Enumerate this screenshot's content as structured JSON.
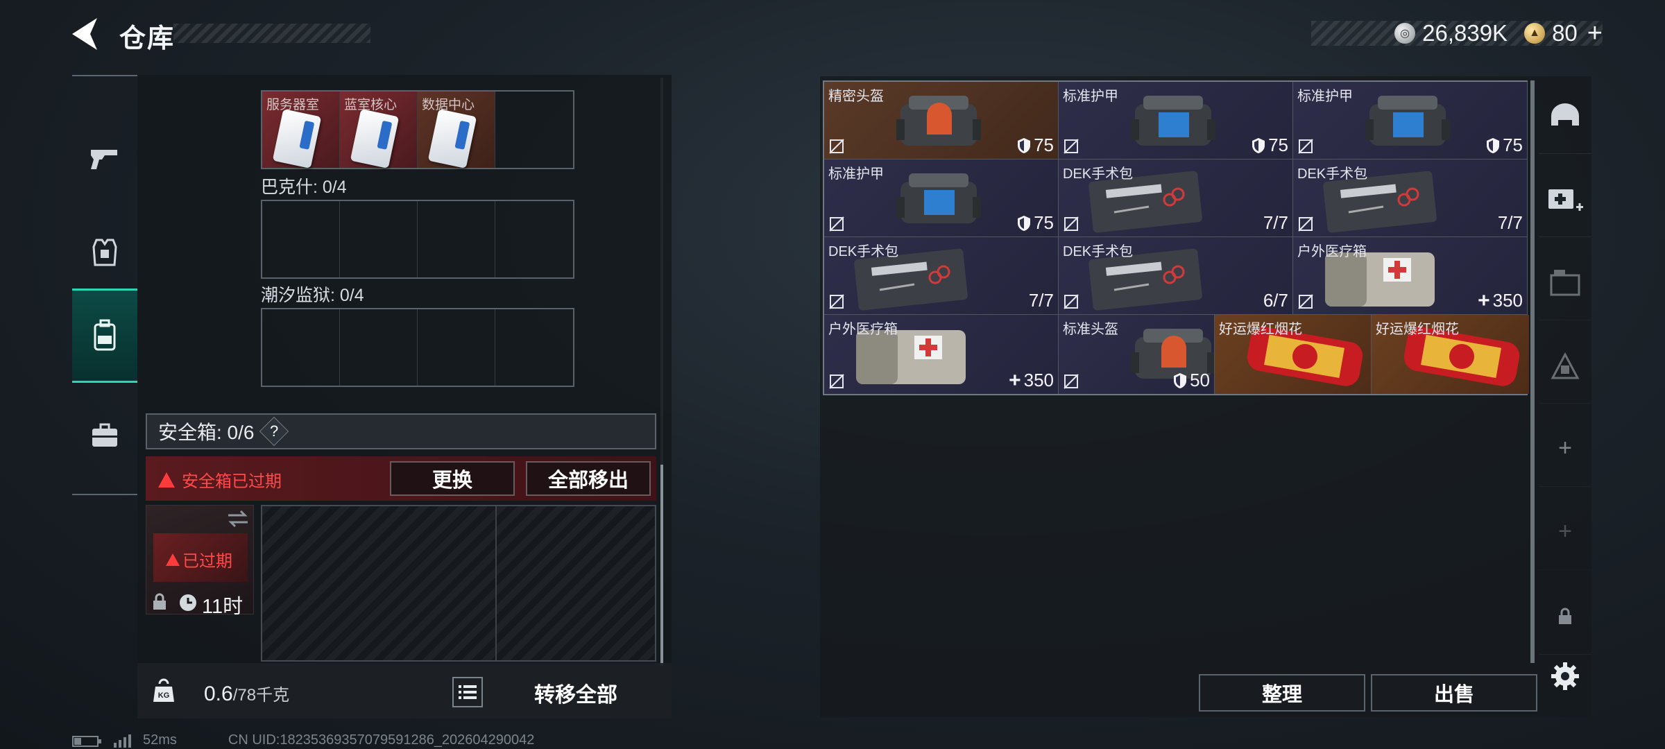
{
  "header": {
    "title": "仓库",
    "currency_silver": "26,839K",
    "currency_gold": "80"
  },
  "left_nav": {
    "items": [
      {
        "name": "weapon",
        "icon": "pistol-icon"
      },
      {
        "name": "armor",
        "icon": "armor-vest-icon"
      },
      {
        "name": "backpack",
        "icon": "backpack-icon",
        "active": true
      },
      {
        "name": "other",
        "icon": "briefcase-icon"
      }
    ]
  },
  "left_panel": {
    "key_cards": {
      "slots": [
        {
          "label": "服务器室",
          "filled": true
        },
        {
          "label": "蓝室核心",
          "filled": true
        },
        {
          "label": "数据中心",
          "filled": true
        },
        {
          "label": "",
          "filled": false
        }
      ]
    },
    "section_bakeshi": "巴克什: 0/4",
    "section_chaoxi": "潮汐监狱: 0/4",
    "safebox_title": "安全箱: 0/6",
    "safebox_help": "?",
    "expired_notice": "安全箱已过期",
    "replace_btn": "更换",
    "remove_all_btn": "全部移出",
    "thumb_expired": "已过期",
    "thumb_time": "11时",
    "weight_current": "0.6",
    "weight_max": "/78千克",
    "transfer_all": "转移全部"
  },
  "status": {
    "ping": "52ms",
    "uid": "CN UID:18235369357079591286_202604290042"
  },
  "items": [
    {
      "name": "精密头盔",
      "value": "75",
      "icon": "shield",
      "bg": "brown",
      "art": "helmet"
    },
    {
      "name": "标准护甲",
      "value": "75",
      "icon": "shield",
      "bg": "purple",
      "art": "armor"
    },
    {
      "name": "标准护甲",
      "value": "75",
      "icon": "shield",
      "bg": "purple",
      "art": "armor"
    },
    {
      "name": "标准护甲",
      "value": "75",
      "icon": "shield",
      "bg": "purple",
      "art": "armor"
    },
    {
      "name": "DEK手术包",
      "value": "7/7",
      "icon": "",
      "bg": "purple",
      "art": "surgery"
    },
    {
      "name": "DEK手术包",
      "value": "7/7",
      "icon": "",
      "bg": "purple",
      "art": "surgery"
    },
    {
      "name": "DEK手术包",
      "value": "7/7",
      "icon": "",
      "bg": "purple",
      "art": "surgery"
    },
    {
      "name": "DEK手术包",
      "value": "6/7",
      "icon": "",
      "bg": "purple",
      "art": "surgery"
    },
    {
      "name": "户外医疗箱",
      "value": "350",
      "icon": "plus",
      "bg": "purple",
      "art": "medkit"
    }
  ],
  "items_row4": [
    {
      "name": "户外医疗箱",
      "value": "350",
      "icon": "plus",
      "bg": "purple",
      "art": "medkit"
    },
    {
      "name": "标准头盔",
      "value": "50",
      "icon": "shield",
      "bg": "purple",
      "art": "helmet"
    },
    {
      "name": "好运爆红烟花",
      "value": "",
      "icon": "",
      "bg": "orange",
      "art": "firework"
    },
    {
      "name": "好运爆红烟花",
      "value": "",
      "icon": "",
      "bg": "orange",
      "art": "firework"
    }
  ],
  "right_tools": [
    "helmet-slot-icon",
    "add-medkit-icon",
    "container-icon",
    "locked-slot-icon",
    "add-icon",
    "add-icon",
    "lock-icon",
    "settings-icon"
  ],
  "bottom_actions": {
    "organize": "整理",
    "sell": "出售"
  },
  "colors": {
    "accent": "#29d6b5",
    "danger": "#ff3b3b",
    "purple_item": "#2e2e4a",
    "brown_item": "#5a3a28",
    "orange_item": "#6b4020"
  }
}
